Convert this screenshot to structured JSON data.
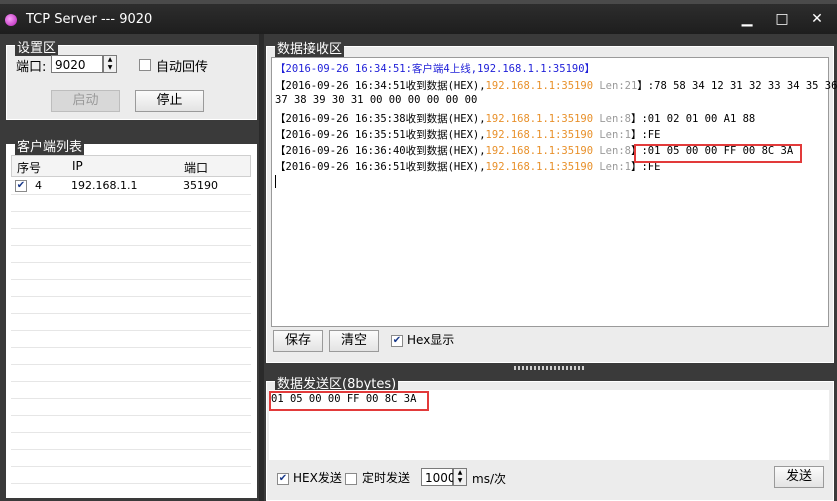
{
  "window": {
    "title": "TCP Server --- 9020",
    "minimize": "▁",
    "maximize": "□",
    "close": "✕"
  },
  "settings": {
    "group_label": "设置区",
    "port_label": "端口:",
    "port_value": "9020",
    "auto_reply_label": "自动回传",
    "start_label": "启动",
    "stop_label": "停止"
  },
  "clients": {
    "group_label": "客户端列表",
    "columns": [
      "序号",
      "IP",
      "端口"
    ],
    "rows": [
      {
        "checked": true,
        "index": "4",
        "ip": "192.168.1.1",
        "port": "35190"
      }
    ]
  },
  "receive": {
    "group_label": "数据接收区",
    "lines": [
      {
        "text": "【2016-09-26 16:34:51:客户端4上线,192.168.1.1:35190】"
      },
      {
        "prefix": "【2016-09-26 16:34:51收到数据(HEX),",
        "ip": "192.168.1.1",
        "sep": ":",
        "port": "35190",
        "len": " Len:21",
        "data": "】:78 58 34 12 31 32 33 34 35 36"
      },
      {
        "text": "37 38 39 30 31 00 00 00 00 00 00"
      },
      {
        "prefix": "【2016-09-26 16:35:38收到数据(HEX),",
        "ip": "192.168.1.1",
        "sep": ":",
        "port": "35190",
        "len": " Len:8",
        "data": "】:01 02 01 00 A1 88"
      },
      {
        "prefix": "【2016-09-26 16:35:51收到数据(HEX),",
        "ip": "192.168.1.1",
        "sep": ":",
        "port": "35190",
        "len": " Len:1",
        "data": "】:FE"
      },
      {
        "prefix": "【2016-09-26 16:36:40收到数据(HEX),",
        "ip": "192.168.1.1",
        "sep": ":",
        "port": "35190",
        "len": " Len:8",
        "data": "】:01 05 00 00 FF 00 8C 3A"
      },
      {
        "prefix": "【2016-09-26 16:36:51收到数据(HEX),",
        "ip": "192.168.1.1",
        "sep": ":",
        "port": "35190",
        "len": " Len:1",
        "data": "】:FE"
      }
    ],
    "save_label": "保存",
    "clear_label": "清空",
    "hex_display_label": "Hex显示"
  },
  "send": {
    "group_label": "数据发送区(8bytes)",
    "content": "01 05 00 00 FF 00 8C 3A",
    "hex_send_label": "HEX发送",
    "timed_send_label": "定时发送",
    "interval_value": "1000",
    "interval_unit": "ms/次",
    "send_label": "发送"
  },
  "colors": {
    "link_blue": "#1f1fd8",
    "orange": "#e8902a",
    "highlight_red": "#e23a3a"
  }
}
